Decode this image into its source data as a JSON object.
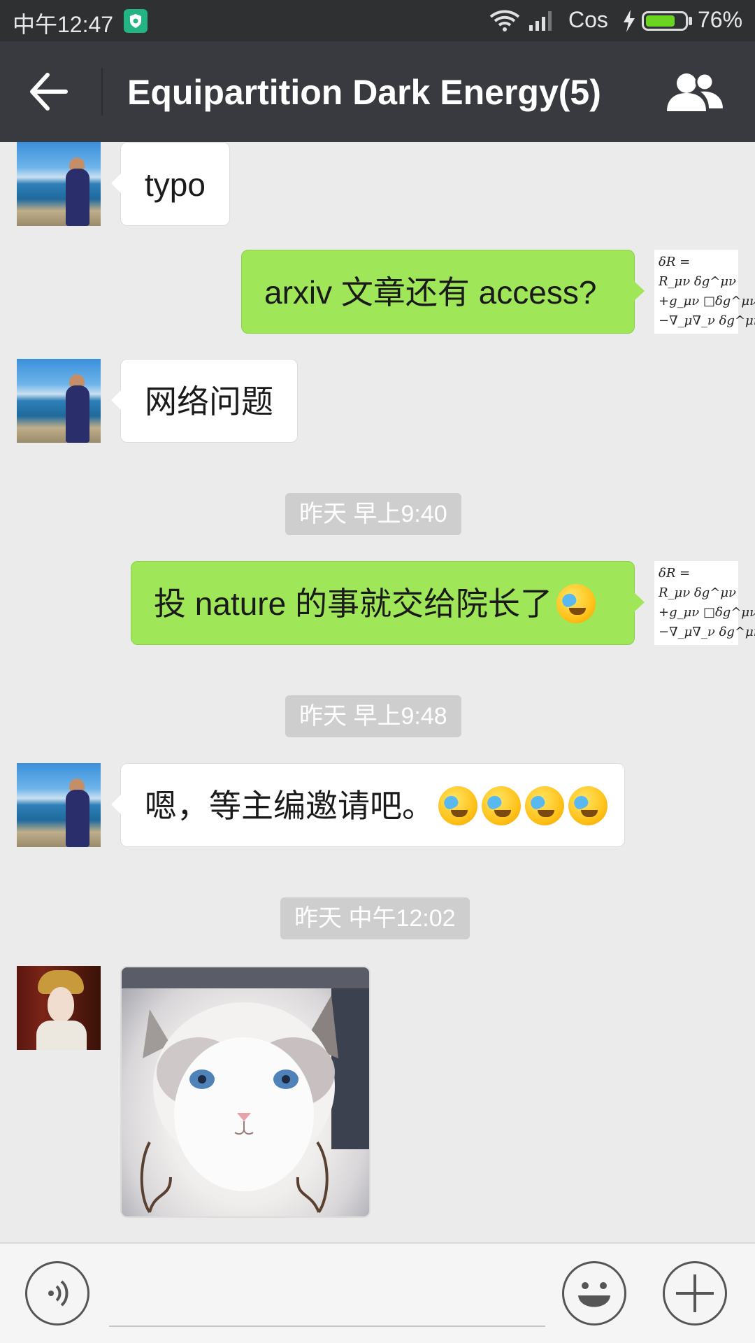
{
  "status_bar": {
    "time": "中午12:47",
    "carrier": "Cos",
    "battery_percent": "76%",
    "battery_level": 0.76,
    "icons": [
      "shield-icon",
      "wifi-icon",
      "signal-icon",
      "charging-icon",
      "battery-icon"
    ]
  },
  "header": {
    "title": "Equipartition Dark Energy(5)",
    "back_icon": "arrow-left-icon",
    "members_icon": "people-icon"
  },
  "self_avatar_text": "δR =\nR_μν δg^μν\n+g_μν □δg^μν\n−∇_μ∇_ν δg^μν",
  "messages": [
    {
      "side": "left",
      "text": "typo"
    },
    {
      "side": "right",
      "text": "arxiv 文章还有 access?"
    },
    {
      "side": "left",
      "text": "网络问题"
    },
    {
      "type": "time",
      "text": "昨天 早上9:40"
    },
    {
      "side": "right",
      "text": "投 nature 的事就交给院长了",
      "emoji_count": 1
    },
    {
      "type": "time",
      "text": "昨天 早上9:48"
    },
    {
      "side": "left",
      "text": "嗯，等主编邀请吧。",
      "emoji_count": 4
    },
    {
      "type": "time",
      "text": "昨天 中午12:02"
    },
    {
      "side": "left",
      "type": "image",
      "image": "cat-photo"
    }
  ],
  "input_bar": {
    "voice_icon": "voice-icon",
    "emoji_icon": "smiley-icon",
    "more_icon": "plus-icon"
  },
  "colors": {
    "title_bar": "#393a3f",
    "status_bar": "#2e3032",
    "chat_bg": "#ebebeb",
    "sent_bubble": "#9fe659",
    "received_bubble": "#ffffff",
    "battery": "#6bd322"
  }
}
